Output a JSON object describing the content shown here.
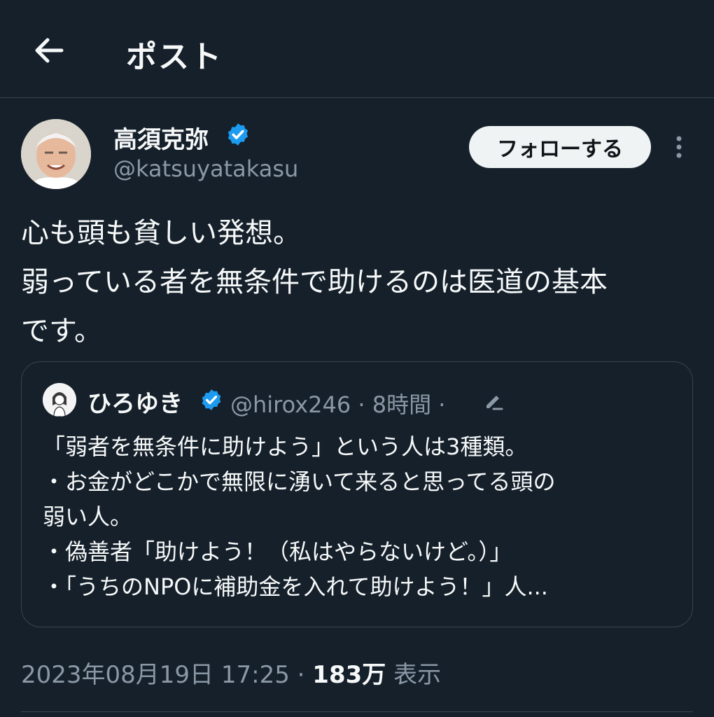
{
  "header": {
    "title": "ポスト"
  },
  "author": {
    "name": "高須克弥",
    "handle": "@katsuyatakasu"
  },
  "follow_label": "フォローする",
  "post_lines": [
    "心も頭も貧しい発想。",
    "弱っている者を無条件で助けるのは医道の基本",
    "です。"
  ],
  "quote": {
    "name": "ひろゆき",
    "meta": "@hirox246 · 8時間 ·",
    "lines": [
      "「弱者を無条件に助けよう」という人は3種類。",
      "・お金がどこかで無限に湧いて来ると思ってる頭の",
      "弱い人。",
      "・偽善者「助けよう！（私はやらないけど。）」",
      "・「うちのNPOに補助金を入れて助けよう！」人..."
    ]
  },
  "footer": {
    "datetime": "2023年08月19日 17:25 · ",
    "views": "183万",
    "views_label": " 表示"
  },
  "colors": {
    "background": "#15202b",
    "verified": "#1d9bf0",
    "muted": "#8b98a5",
    "border": "#38444d"
  }
}
